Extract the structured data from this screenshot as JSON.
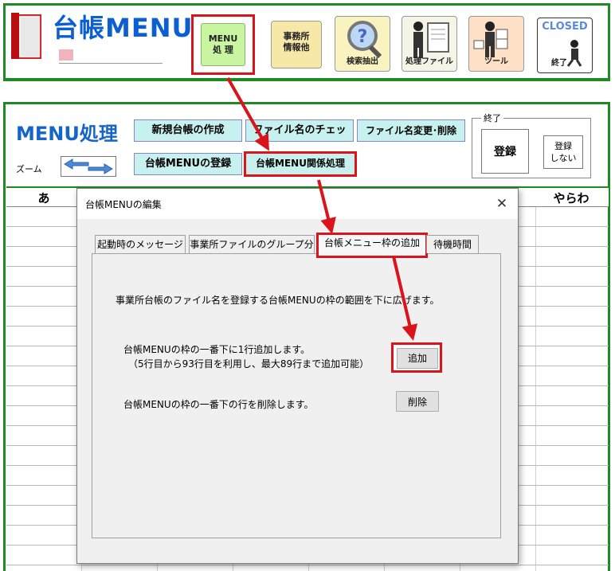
{
  "app": {
    "title": "台帳MENU"
  },
  "toolbar": {
    "menu_proc_line1": "MENU",
    "menu_proc_line2": "処 理",
    "office_line1": "事務所",
    "office_line2": "情報他",
    "search_label": "検索抽出",
    "procfile_label": "処理ファイル",
    "tools_label": "ツール",
    "closed_label": "CLOSED",
    "closed_sub": "終了"
  },
  "sheet": {
    "title": "MENU処理",
    "zoom_label": "ズーム",
    "buttons": {
      "new_ledger": "新規台帳の作成",
      "file_check": "ファイル名のチェッ",
      "file_change": "ファイル名変更･削除",
      "register_menu": "台帳MENUの登録",
      "menu_related": "台帳MENU関係処理"
    },
    "end_group": {
      "legend": "終了",
      "register": "登録",
      "no_register_line1": "登録",
      "no_register_line2": "しない"
    },
    "columns": [
      "あ",
      "やらわ"
    ]
  },
  "dialog": {
    "title": "台帳MENUの編集",
    "close_glyph": "✕",
    "tabs": [
      "起動時のメッセージ",
      "事業所ファイルのグループ分",
      "台帳メニュー枠の追加",
      "待機時間"
    ],
    "description": "事業所台帳のファイル名を登録する台帳MENUの枠の範囲を下に広げます。",
    "add_line1": "台帳MENUの枠の一番下に1行追加します。",
    "add_line2": "（5行目から93行目を利用し、最大89行まで追加可能）",
    "add_button": "追加",
    "delete_line": "台帳MENUの枠の一番下の行を削除します。",
    "delete_button": "削除"
  },
  "colors": {
    "frame_green": "#1e8a24",
    "highlight_red": "#d9141a",
    "title_blue": "#0b5fd0",
    "menu_button": "#c7f1ef"
  }
}
